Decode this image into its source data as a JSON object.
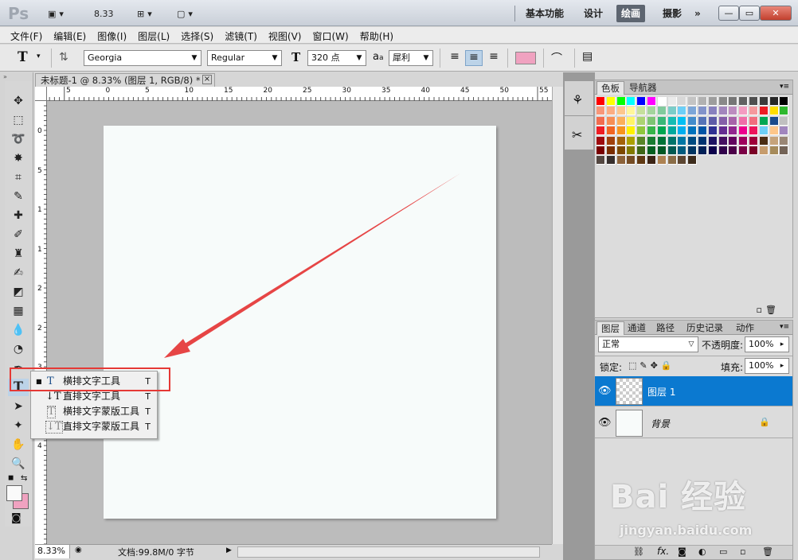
{
  "app": {
    "logo": "Ps",
    "zoom_value": "8.33"
  },
  "workspaces": [
    "基本功能",
    "设计",
    "绘画",
    "摄影"
  ],
  "active_workspace": "绘画",
  "window_buttons": [
    "最小化",
    "最大化",
    "关闭"
  ],
  "menu": [
    "文件(F)",
    "编辑(E)",
    "图像(I)",
    "图层(L)",
    "选择(S)",
    "滤镜(T)",
    "视图(V)",
    "窗口(W)",
    "帮助(H)"
  ],
  "options_bar": {
    "tool_glyph": "T",
    "font_family": "Georgia",
    "font_style": "Regular",
    "font_size": "320 点",
    "antialias": "犀利",
    "antialias_prefix": "a",
    "color_swatch": "#f0a2c0"
  },
  "document": {
    "tab_title": "未标题-1 @ 8.33% (图层 1, RGB/8) *",
    "close_glyph": "×",
    "zoom": "8.33%",
    "status": "文档:99.8M/0 字节",
    "ruler_top": [
      "5",
      "0",
      "5",
      "10",
      "15",
      "20",
      "25",
      "30",
      "35",
      "40",
      "45",
      "50",
      "55"
    ],
    "ruler_left": [
      "0",
      "5",
      "1",
      "1",
      "2",
      "2",
      "3",
      "3",
      "4"
    ]
  },
  "flyout": {
    "items": [
      {
        "icon": "T",
        "label": "横排文字工具",
        "key": "T",
        "selected": true
      },
      {
        "icon": "T",
        "label": "直排文字工具",
        "key": "T",
        "selected": false
      },
      {
        "icon": "T",
        "label": "横排文字蒙版工具",
        "key": "T",
        "selected": false
      },
      {
        "icon": "T",
        "label": "直排文字蒙版工具",
        "key": "T",
        "selected": false
      }
    ],
    "marker": "■"
  },
  "color_panel": {
    "tabs": [
      "色板",
      "导航器"
    ],
    "active_tab": "色板"
  },
  "layers_panel": {
    "tabs": [
      "图层",
      "通道",
      "路径",
      "历史记录",
      "动作"
    ],
    "blend_mode": "正常",
    "opacity_label": "不透明度:",
    "opacity": "100%",
    "lock_label": "锁定:",
    "fill_label": "填充:",
    "fill": "100%",
    "layers": [
      {
        "name": "图层 1",
        "selected": true,
        "transparent": true
      },
      {
        "name": "背景",
        "selected": false,
        "transparent": false,
        "locked": true
      }
    ],
    "footer_fx": "fx."
  },
  "watermark": {
    "logo": "Bai 经验",
    "url": "jingyan.baidu.com"
  },
  "colors": {
    "accent_highlight": "#e53935",
    "layer_selected": "#0b79d0",
    "arrow": "#e64545"
  }
}
